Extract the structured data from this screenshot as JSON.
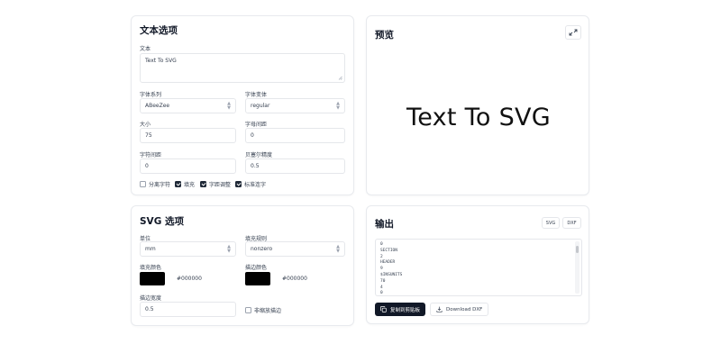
{
  "text_options": {
    "title": "文本选项",
    "text_label": "文本",
    "text_value": "Text To SVG",
    "font_family_label": "字体系列",
    "font_family_value": "ABeeZee",
    "font_variant_label": "字体变体",
    "font_variant_value": "regular",
    "size_label": "大小",
    "size_value": "75",
    "letter_spacing_label": "字母间距",
    "letter_spacing_value": "0",
    "line_spacing_label": "字符间距",
    "line_spacing_value": "0",
    "bezier_accuracy_label": "贝塞尔精度",
    "bezier_accuracy_value": "0.5",
    "checkboxes": [
      {
        "label": "分离字符",
        "checked": false
      },
      {
        "label": "填充",
        "checked": true
      },
      {
        "label": "字距调整",
        "checked": true
      },
      {
        "label": "标准连字",
        "checked": true
      }
    ]
  },
  "svg_options": {
    "title": "SVG 选项",
    "unit_label": "单位",
    "unit_value": "mm",
    "fill_rule_label": "填充规则",
    "fill_rule_value": "nonzero",
    "fill_color_label": "填充颜色",
    "fill_color_value": "#000000",
    "stroke_color_label": "描边颜色",
    "stroke_color_value": "#000000",
    "stroke_width_label": "描边宽度",
    "stroke_width_value": "0.5",
    "nonscaling_label": "非缩放描边",
    "nonscaling_checked": false
  },
  "preview": {
    "title": "预览",
    "text": "Text To SVG",
    "expand_icon": "expand-icon"
  },
  "output": {
    "title": "输出",
    "svg_tab": "SVG",
    "dxf_tab": "DXF",
    "code_lines": [
      "0",
      "SECTION",
      "2",
      "HEADER",
      "9",
      "$INSUNITS",
      "70",
      "4",
      "0"
    ],
    "copy_button": "复制到剪贴板",
    "download_button": "Download DXF",
    "copy_icon": "copy-icon",
    "download_icon": "download-icon"
  }
}
